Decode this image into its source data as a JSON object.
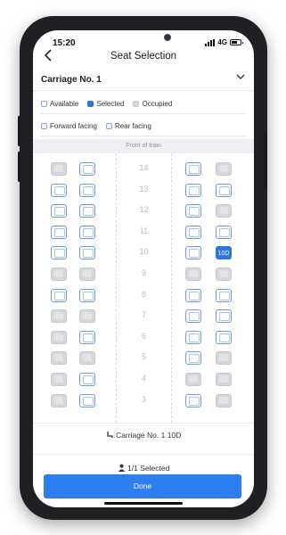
{
  "status": {
    "time": "15:20",
    "network": "4G"
  },
  "nav": {
    "back_icon": "back-arrow-icon",
    "title": "Seat Selection"
  },
  "carriage_select": {
    "label": "Carriage No. 1",
    "chevron_icon": "chevron-down-icon"
  },
  "legend": {
    "available": "Available",
    "selected": "Selected",
    "occupied": "Occupied",
    "forward": "Forward facing",
    "rear": "Rear facing"
  },
  "front_label": "Front of train",
  "rows": [
    "14",
    "13",
    "12",
    "11",
    "10",
    "9",
    "8",
    "7",
    "6",
    "5",
    "4",
    "3"
  ],
  "seat_map": [
    [
      "occ",
      "avail",
      "avail",
      "occ"
    ],
    [
      "avail",
      "avail",
      "avail",
      "avail"
    ],
    [
      "avail",
      "avail",
      "avail",
      "occ"
    ],
    [
      "avail",
      "avail",
      "avail",
      "avail"
    ],
    [
      "avail",
      "avail",
      "avail",
      "sel"
    ],
    [
      "occ",
      "occ",
      "occ",
      "occ"
    ],
    [
      "avail",
      "avail",
      "avail",
      "avail"
    ],
    [
      "occ",
      "occ",
      "avail",
      "avail"
    ],
    [
      "occ",
      "avail",
      "avail",
      "avail"
    ],
    [
      "occ",
      "occ",
      "avail",
      "occ"
    ],
    [
      "occ",
      "avail",
      "occ",
      "occ"
    ],
    [
      "occ",
      "avail",
      "avail",
      "occ"
    ]
  ],
  "selected_seat_label": "10D",
  "summary": {
    "seat_line": "Carriage No. 1 10D",
    "seat_icon": "seat-icon",
    "count_line": "1/1 Selected",
    "person_icon": "person-icon"
  },
  "done_label": "Done",
  "colors": {
    "accent": "#2d7ff0",
    "available_border": "#6f9ad8",
    "occupied": "#d5d7db"
  }
}
